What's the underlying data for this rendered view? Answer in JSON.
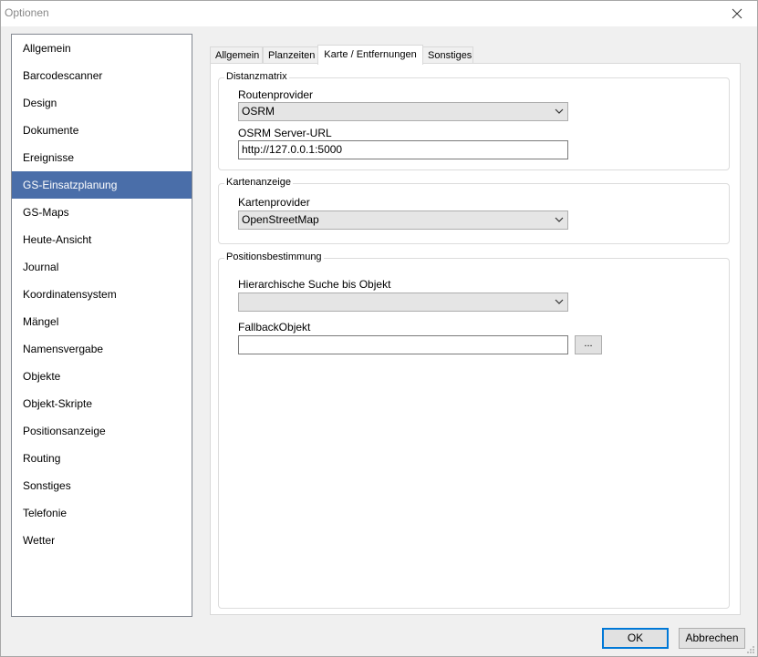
{
  "window": {
    "title": "Optionen"
  },
  "sidebar": {
    "items": [
      {
        "label": "Allgemein"
      },
      {
        "label": "Barcodescanner"
      },
      {
        "label": "Design"
      },
      {
        "label": "Dokumente"
      },
      {
        "label": "Ereignisse"
      },
      {
        "label": "GS-Einsatzplanung"
      },
      {
        "label": "GS-Maps"
      },
      {
        "label": "Heute-Ansicht"
      },
      {
        "label": "Journal"
      },
      {
        "label": "Koordinatensystem"
      },
      {
        "label": "Mängel"
      },
      {
        "label": "Namensvergabe"
      },
      {
        "label": "Objekte"
      },
      {
        "label": "Objekt-Skripte"
      },
      {
        "label": "Positionsanzeige"
      },
      {
        "label": "Routing"
      },
      {
        "label": "Sonstiges"
      },
      {
        "label": "Telefonie"
      },
      {
        "label": "Wetter"
      }
    ],
    "selected": "GS-Einsatzplanung"
  },
  "tabs": [
    {
      "label": "Allgemein"
    },
    {
      "label": "Planzeiten"
    },
    {
      "label": "Karte / Entfernungen"
    },
    {
      "label": "Sonstiges"
    }
  ],
  "active_tab": "Karte / Entfernungen",
  "distanzmatrix": {
    "title": "Distanzmatrix",
    "routenprovider_label": "Routenprovider",
    "routenprovider_value": "OSRM",
    "server_url_label": "OSRM Server-URL",
    "server_url_value": "http://127.0.0.1:5000"
  },
  "kartenanzeige": {
    "title": "Kartenanzeige",
    "kartenprovider_label": "Kartenprovider",
    "kartenprovider_value": "OpenStreetMap"
  },
  "positionsbestimmung": {
    "title": "Positionsbestimmung",
    "hier_search_label": "Hierarchische Suche bis Objekt",
    "hier_search_value": "",
    "fallback_label": "FallbackObjekt",
    "fallback_value": "",
    "browse_label": "..."
  },
  "footer": {
    "ok_label": "OK",
    "cancel_label": "Abbrechen"
  },
  "colors": {
    "selection": "#4a6ea9",
    "default_button_border": "#0078d7"
  },
  "icons": {
    "close": "close-icon",
    "dropdown": "chevron-down-icon",
    "resize": "resize-grip-icon"
  }
}
